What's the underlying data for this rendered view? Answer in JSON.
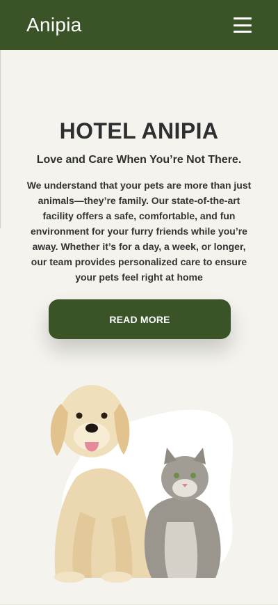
{
  "header": {
    "brand": "Anipia",
    "menu_icon": "hamburger-menu-icon"
  },
  "hero": {
    "title": "HOTEL ANIPIA",
    "subtitle": "Love and Care When You’re Not There.",
    "description": "We understand that your pets are more than just animals—they’re family. Our state-of-the-art facility offers a safe, comfortable, and fun environment for your furry friends while you’re away. Whether it’s for a day, a week, or longer, our team provides personalized care to ensure your pets feel right at home",
    "cta_label": "READ MORE"
  },
  "image": {
    "subject": "golden-retriever-and-cat"
  },
  "colors": {
    "brand_green": "#3a5428",
    "page_background": "#f4f3ee",
    "blob": "#ffffff"
  }
}
